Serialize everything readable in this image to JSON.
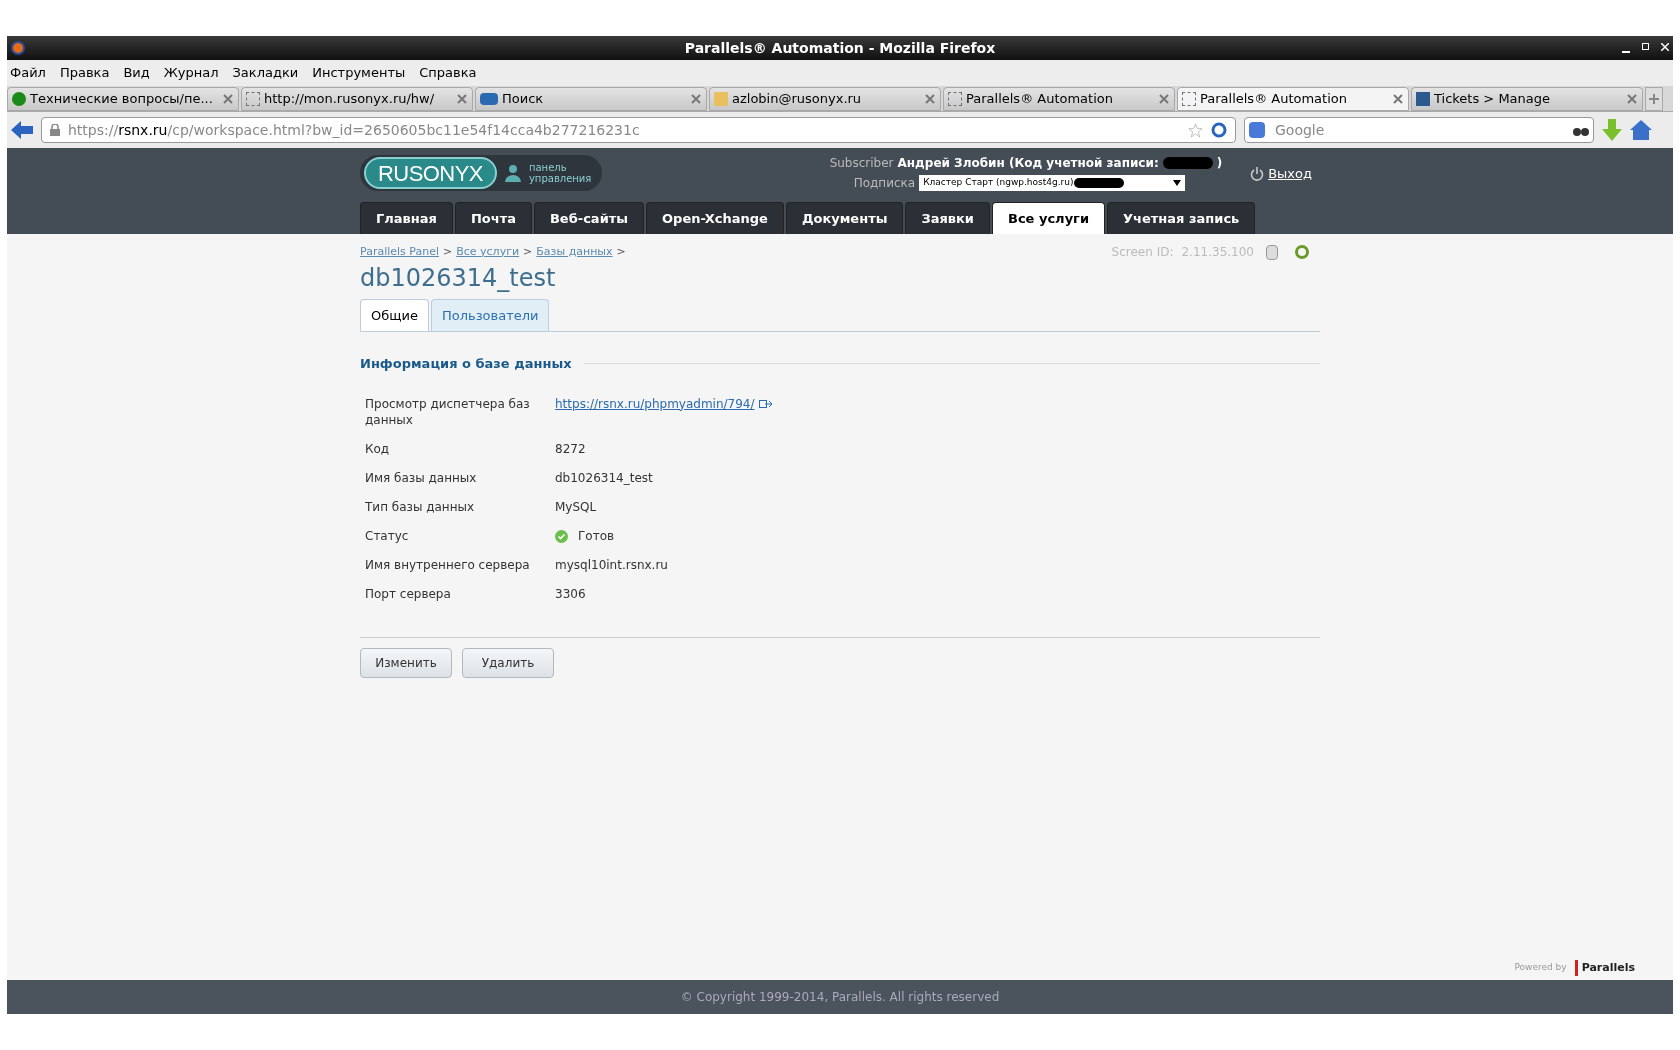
{
  "window": {
    "title": "Parallels® Automation - Mozilla Firefox"
  },
  "menu": [
    "Файл",
    "Правка",
    "Вид",
    "Журнал",
    "Закладки",
    "Инструменты",
    "Справка"
  ],
  "tabs": [
    {
      "label": "Технические вопросы/пе...",
      "kind": "round",
      "selected": false
    },
    {
      "label": "http://mon.rusonyx.ru/hw/",
      "kind": "blank",
      "selected": false
    },
    {
      "label": "Поиск",
      "kind": "wide",
      "selected": false
    },
    {
      "label": "azlobin@rusonyx.ru",
      "kind": "mail",
      "selected": false
    },
    {
      "label": "Parallels® Automation",
      "kind": "blank",
      "selected": false
    },
    {
      "label": "Parallels® Automation",
      "kind": "blank",
      "selected": true
    },
    {
      "label": "Tickets > Manage",
      "kind": "square",
      "selected": false
    }
  ],
  "url": {
    "prefix": "https://",
    "host": "rsnx.ru",
    "path": "/cp/workspace.html?bw_id=2650605bc11e54f14cca4b277216231c"
  },
  "search": {
    "placeholder": "Google"
  },
  "header": {
    "logo": "RUSONYX",
    "panel_label": "панель управления",
    "subscriber_label": "Subscriber",
    "subscriber_name": "Андрей Злобин (Код учетной записи:",
    "subscriber_close": ")",
    "subscription_label": "Подписка",
    "subscription_value": "Кластер Старт (ngwp.host4g.ru)",
    "logout": "Выход"
  },
  "nav": [
    {
      "label": "Главная",
      "selected": false
    },
    {
      "label": "Почта",
      "selected": false
    },
    {
      "label": "Веб-сайты",
      "selected": false
    },
    {
      "label": "Open-Xchange",
      "selected": false
    },
    {
      "label": "Документы",
      "selected": false
    },
    {
      "label": "Заявки",
      "selected": false
    },
    {
      "label": "Все услуги",
      "selected": true
    },
    {
      "label": "Учетная запись",
      "selected": false
    }
  ],
  "breadcrumbs": [
    {
      "label": "Parallels Panel",
      "separator": ">"
    },
    {
      "label": "Все услуги",
      "separator": ">"
    },
    {
      "label": "Базы данных",
      "separator": ">"
    }
  ],
  "screen_id": {
    "label": "Screen ID:",
    "value": "2.11.35.100"
  },
  "page_title": "db1026314_test",
  "page_tabs": [
    {
      "label": "Общие",
      "selected": true
    },
    {
      "label": "Пользователи",
      "selected": false
    }
  ],
  "section_title": "Информация о базе данных",
  "fields": [
    {
      "label": "Просмотр диспетчера баз данных",
      "value": "https://rsnx.ru/phpmyadmin/794/",
      "kind": "link"
    },
    {
      "label": "Код",
      "value": "8272",
      "kind": "text"
    },
    {
      "label": "Имя базы данных",
      "value": "db1026314_test",
      "kind": "text"
    },
    {
      "label": "Тип базы данных",
      "value": "MySQL",
      "kind": "text"
    },
    {
      "label": "Статус",
      "value": "Готов",
      "kind": "status"
    },
    {
      "label": "Имя внутреннего сервера",
      "value": "mysql10int.rsnx.ru",
      "kind": "text"
    },
    {
      "label": "Порт сервера",
      "value": "3306",
      "kind": "text"
    }
  ],
  "buttons": [
    "Изменить",
    "Удалить"
  ],
  "powered_by": {
    "label": "Powered by",
    "brand": "Parallels"
  },
  "footer": "© Copyright 1999-2014, Parallels. All rights reserved"
}
